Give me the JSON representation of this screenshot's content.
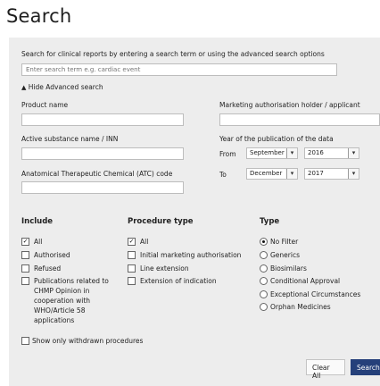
{
  "page_title": "Search",
  "instructions": "Search for clinical reports by entering a search term or using the advanced search options",
  "search_placeholder": "Enter search term e.g. cardiac event",
  "toggle_advanced": "Hide Advanced search",
  "fields": {
    "product_name": "Product name",
    "mah": "Marketing authorisation holder / applicant",
    "active_substance": "Active substance name / INN",
    "year_label": "Year of the publication of the data",
    "from_label": "From",
    "to_label": "To",
    "from_month": "September",
    "from_year": "2016",
    "to_month": "December",
    "to_year": "2017",
    "atc": "Anatomical Therapeutic Chemical (ATC) code"
  },
  "include": {
    "heading": "Include",
    "items": [
      {
        "label": "All",
        "checked": true
      },
      {
        "label": "Authorised",
        "checked": false
      },
      {
        "label": "Refused",
        "checked": false
      },
      {
        "label_lines": [
          "Publications related to",
          "CHMP Opinion in",
          "cooperation with",
          "WHO/Article 58",
          "applications"
        ],
        "checked": false
      }
    ]
  },
  "procedure": {
    "heading": "Procedure type",
    "items": [
      {
        "label": "All",
        "checked": true
      },
      {
        "label": "Initial marketing authorisation",
        "checked": false
      },
      {
        "label": "Line extension",
        "checked": false
      },
      {
        "label": "Extension of indication",
        "checked": false
      }
    ]
  },
  "type": {
    "heading": "Type",
    "items": [
      {
        "label": "No Filter",
        "selected": true
      },
      {
        "label": "Generics",
        "selected": false
      },
      {
        "label": "Biosimilars",
        "selected": false
      },
      {
        "label": "Conditional Approval",
        "selected": false
      },
      {
        "label": "Exceptional Circumstances",
        "selected": false
      },
      {
        "label": "Orphan Medicines",
        "selected": false
      }
    ]
  },
  "withdrawn_label": "Show only withdrawn procedures",
  "clear_all_label": "Clear All",
  "search_label": "Search",
  "arrow_glyph": "▾",
  "check_glyph": "✓",
  "colors": {
    "primary_button": "#25407a",
    "panel_bg": "#ededed"
  }
}
